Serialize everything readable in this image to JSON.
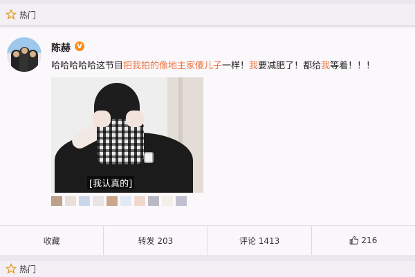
{
  "hot_bar": {
    "label": "热门"
  },
  "post": {
    "username": "陈赫",
    "verified_badge": "V",
    "text_segments": [
      {
        "text": "哈哈哈哈哈这节目",
        "highlight": false
      },
      {
        "text": "把我拍的像地主家傻儿子",
        "highlight": true
      },
      {
        "text": "一样！",
        "highlight": false
      },
      {
        "text": "我",
        "highlight": true
      },
      {
        "text": "要减肥了！都给",
        "highlight": false
      },
      {
        "text": "我",
        "highlight": true
      },
      {
        "text": "等着！！！",
        "highlight": false
      }
    ],
    "media": {
      "subtitle": "[我认真的]"
    },
    "thumbnails": [
      "#bca08a",
      "#eadfd8",
      "#c9d7ea",
      "#e8e4e6",
      "#caa68a",
      "#dfeaf6",
      "#f0d8ce",
      "#b9b9c4",
      "#f3efe9",
      "#c0c0d0"
    ]
  },
  "actions": {
    "favorite": "收藏",
    "repost": "转发 203",
    "comment": "评论 1413",
    "like": "216"
  },
  "bottom_bar": {
    "label": "热门"
  }
}
